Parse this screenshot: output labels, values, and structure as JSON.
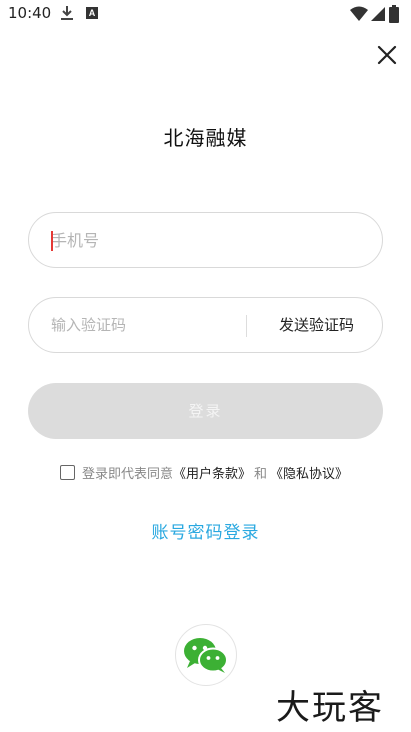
{
  "status_bar": {
    "time": "10:40",
    "a_badge": "A",
    "icons": [
      "download-icon",
      "a-icon",
      "wifi-icon",
      "signal-icon",
      "battery-icon"
    ]
  },
  "header": {
    "close_icon": "close-icon"
  },
  "app": {
    "title": "北海融媒"
  },
  "phone": {
    "placeholder": "手机号",
    "value": ""
  },
  "code": {
    "placeholder": "输入验证码",
    "value": "",
    "send_label": "发送验证码"
  },
  "login": {
    "label": "登录"
  },
  "agreement": {
    "checked": false,
    "prefix": "登录即代表同意",
    "terms": "《用户条款》",
    "and": "和",
    "privacy": "《隐私协议》"
  },
  "account_login": {
    "label": "账号密码登录"
  },
  "social": {
    "wechat_icon": "wechat-icon"
  },
  "watermark": {
    "text": "大玩客"
  },
  "colors": {
    "accent": "#29a8e0",
    "wechat": "#3cb034",
    "disabled_button": "#dcdcdc",
    "caret": "#e53935"
  }
}
